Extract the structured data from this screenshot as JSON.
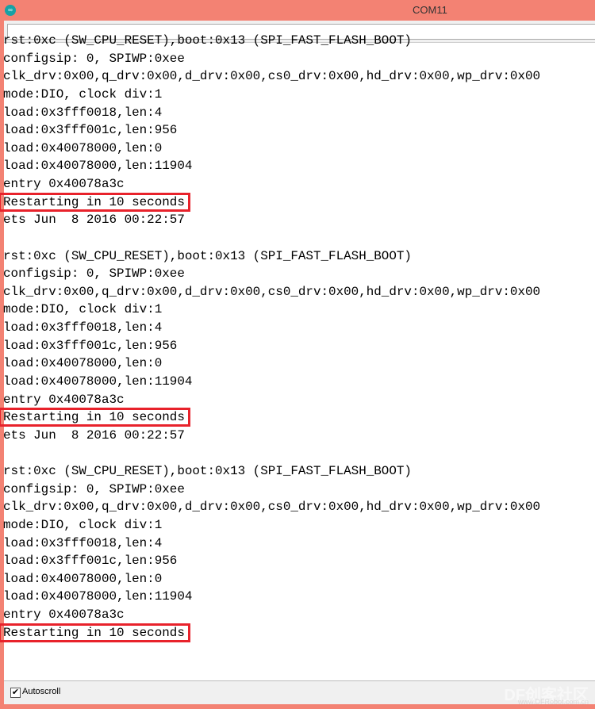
{
  "window": {
    "title": "COM11",
    "icon": "arduino-icon"
  },
  "input": {
    "value": ""
  },
  "output": {
    "lines": [
      "rst:0xc (SW_CPU_RESET),boot:0x13 (SPI_FAST_FLASH_BOOT)",
      "configsip: 0, SPIWP:0xee",
      "clk_drv:0x00,q_drv:0x00,d_drv:0x00,cs0_drv:0x00,hd_drv:0x00,wp_drv:0x00",
      "mode:DIO, clock div:1",
      "load:0x3fff0018,len:4",
      "load:0x3fff001c,len:956",
      "load:0x40078000,len:0",
      "load:0x40078000,len:11904",
      "entry 0x40078a3c",
      "Restarting in 10 seconds",
      "ets Jun  8 2016 00:22:57",
      "",
      "rst:0xc (SW_CPU_RESET),boot:0x13 (SPI_FAST_FLASH_BOOT)",
      "configsip: 0, SPIWP:0xee",
      "clk_drv:0x00,q_drv:0x00,d_drv:0x00,cs0_drv:0x00,hd_drv:0x00,wp_drv:0x00",
      "mode:DIO, clock div:1",
      "load:0x3fff0018,len:4",
      "load:0x3fff001c,len:956",
      "load:0x40078000,len:0",
      "load:0x40078000,len:11904",
      "entry 0x40078a3c",
      "Restarting in 10 seconds",
      "ets Jun  8 2016 00:22:57",
      "",
      "rst:0xc (SW_CPU_RESET),boot:0x13 (SPI_FAST_FLASH_BOOT)",
      "configsip: 0, SPIWP:0xee",
      "clk_drv:0x00,q_drv:0x00,d_drv:0x00,cs0_drv:0x00,hd_drv:0x00,wp_drv:0x00",
      "mode:DIO, clock div:1",
      "load:0x3fff0018,len:4",
      "load:0x3fff001c,len:956",
      "load:0x40078000,len:0",
      "load:0x40078000,len:11904",
      "entry 0x40078a3c",
      "Restarting in 10 seconds"
    ],
    "highlight_color": "#e8222b"
  },
  "footer": {
    "autoscroll_label": "Autoscroll",
    "autoscroll_checked": true
  },
  "watermark": {
    "text": "DF创客社区",
    "url": "www.DFRobot.com.cn"
  }
}
